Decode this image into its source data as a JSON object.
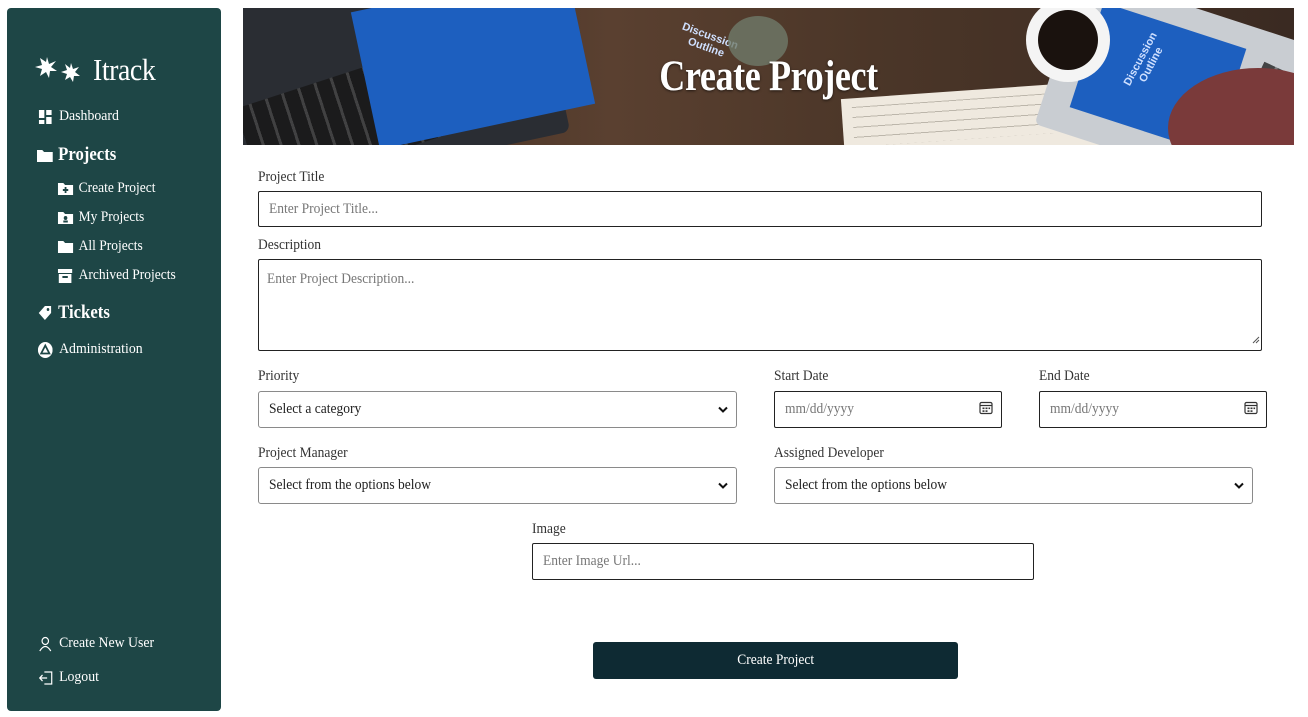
{
  "brand": {
    "name": "Itrack",
    "icon": "asterisk-logo-icon"
  },
  "sidebar": {
    "dashboard": {
      "label": "Dashboard",
      "icon": "dashboard-grid-icon"
    },
    "projects": {
      "label": "Projects",
      "icon": "folder-open-icon"
    },
    "project_items": [
      {
        "label": "Create Project",
        "icon": "folder-plus-icon"
      },
      {
        "label": "My Projects",
        "icon": "folder-user-icon"
      },
      {
        "label": "All Projects",
        "icon": "folder-icon"
      },
      {
        "label": "Archived Projects",
        "icon": "archive-icon"
      }
    ],
    "tickets": {
      "label": "Tickets",
      "icon": "tag-icon"
    },
    "administration": {
      "label": "Administration",
      "icon": "triangle-circle-icon"
    },
    "create_user": {
      "label": "Create New User",
      "icon": "user-icon"
    },
    "logout": {
      "label": "Logout",
      "icon": "logout-icon"
    }
  },
  "banner": {
    "title": "Create Project",
    "screen_text_left": "Discussion Outline",
    "screen_text_right": "Discussion Outline"
  },
  "form": {
    "title": {
      "label": "Project Title",
      "placeholder": "Enter Project Title..."
    },
    "description": {
      "label": "Description",
      "placeholder": "Enter Project Description..."
    },
    "priority": {
      "label": "Priority",
      "selected": "Select a category"
    },
    "start_date": {
      "label": "Start Date",
      "placeholder": "mm/dd/yyyy"
    },
    "end_date": {
      "label": "End Date",
      "placeholder": "mm/dd/yyyy"
    },
    "project_manager": {
      "label": "Project Manager",
      "selected": "Select from the options below"
    },
    "assigned_developer": {
      "label": "Assigned Developer",
      "selected": "Select from the options below"
    },
    "image": {
      "label": "Image",
      "placeholder": "Enter Image Url..."
    },
    "submit_label": "Create Project"
  },
  "colors": {
    "sidebar_bg": "#1e4646",
    "button_bg": "#0e2a33"
  }
}
